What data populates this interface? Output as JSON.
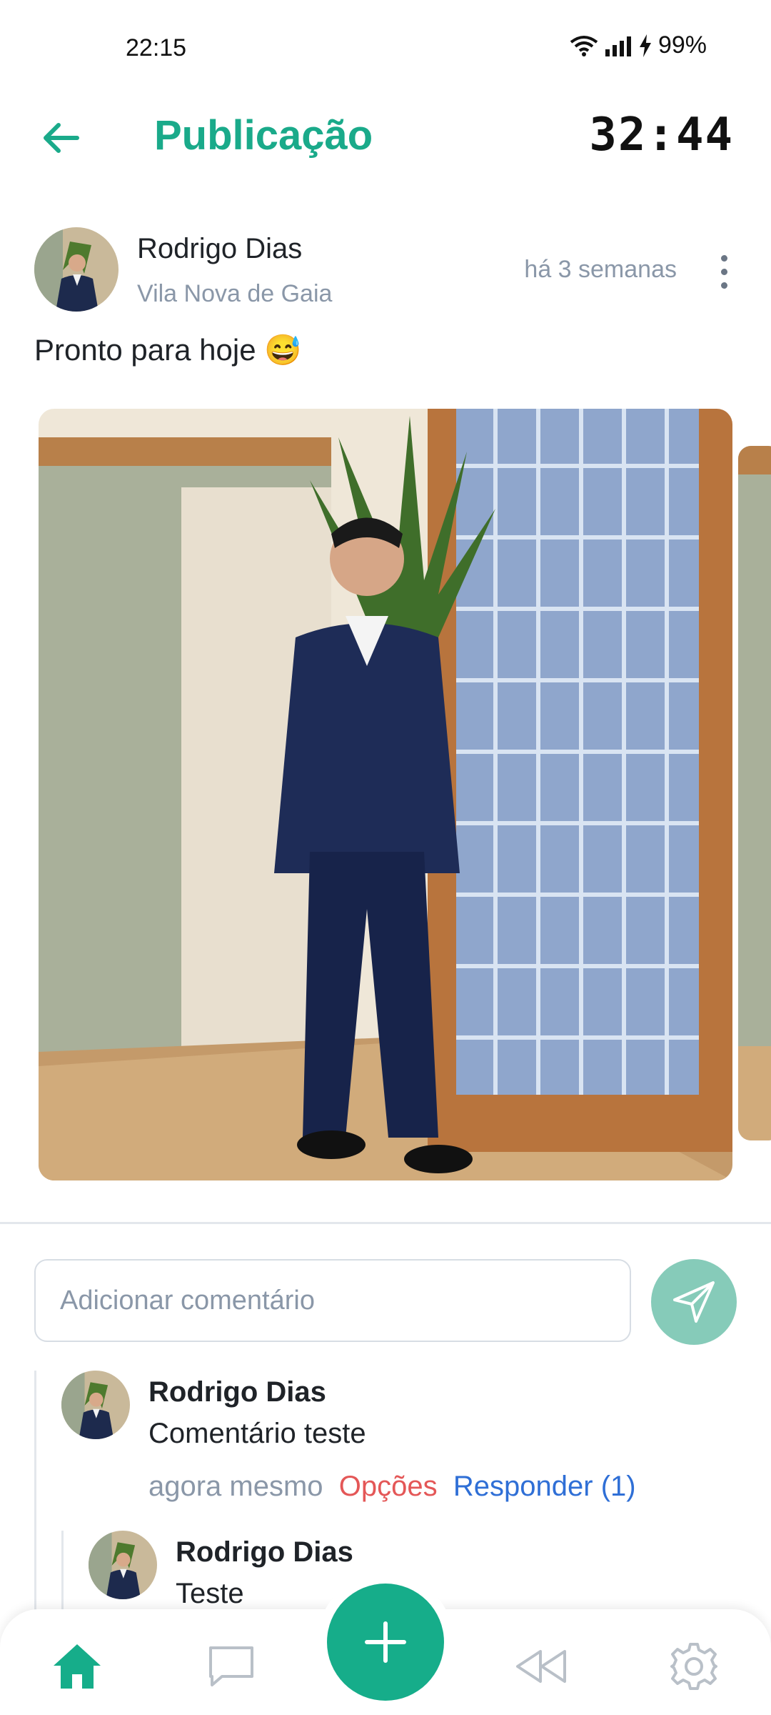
{
  "status_bar": {
    "time": "22:15",
    "battery": "99%"
  },
  "header": {
    "title": "Publicação",
    "timer": "32:44"
  },
  "post": {
    "author": "Rodrigo Dias",
    "location": "Vila Nova de Gaia",
    "time_ago": "há 3 semanas",
    "text": "Pronto para hoje 😅"
  },
  "comment_input": {
    "placeholder": "Adicionar comentário"
  },
  "comments": [
    {
      "author": "Rodrigo Dias",
      "text": "Comentário teste",
      "time": "agora mesmo",
      "options_label": "Opções",
      "reply_label": "Responder (1)",
      "replies": [
        {
          "author": "Rodrigo Dias",
          "text": "Teste"
        }
      ]
    }
  ],
  "colors": {
    "accent": "#1aaa8a",
    "danger": "#e45757",
    "link": "#2f6fd6",
    "muted": "#8a97a8"
  },
  "nav": {
    "items": [
      "home-icon",
      "chat-icon",
      "add-icon",
      "rewind-icon",
      "settings-icon"
    ]
  }
}
